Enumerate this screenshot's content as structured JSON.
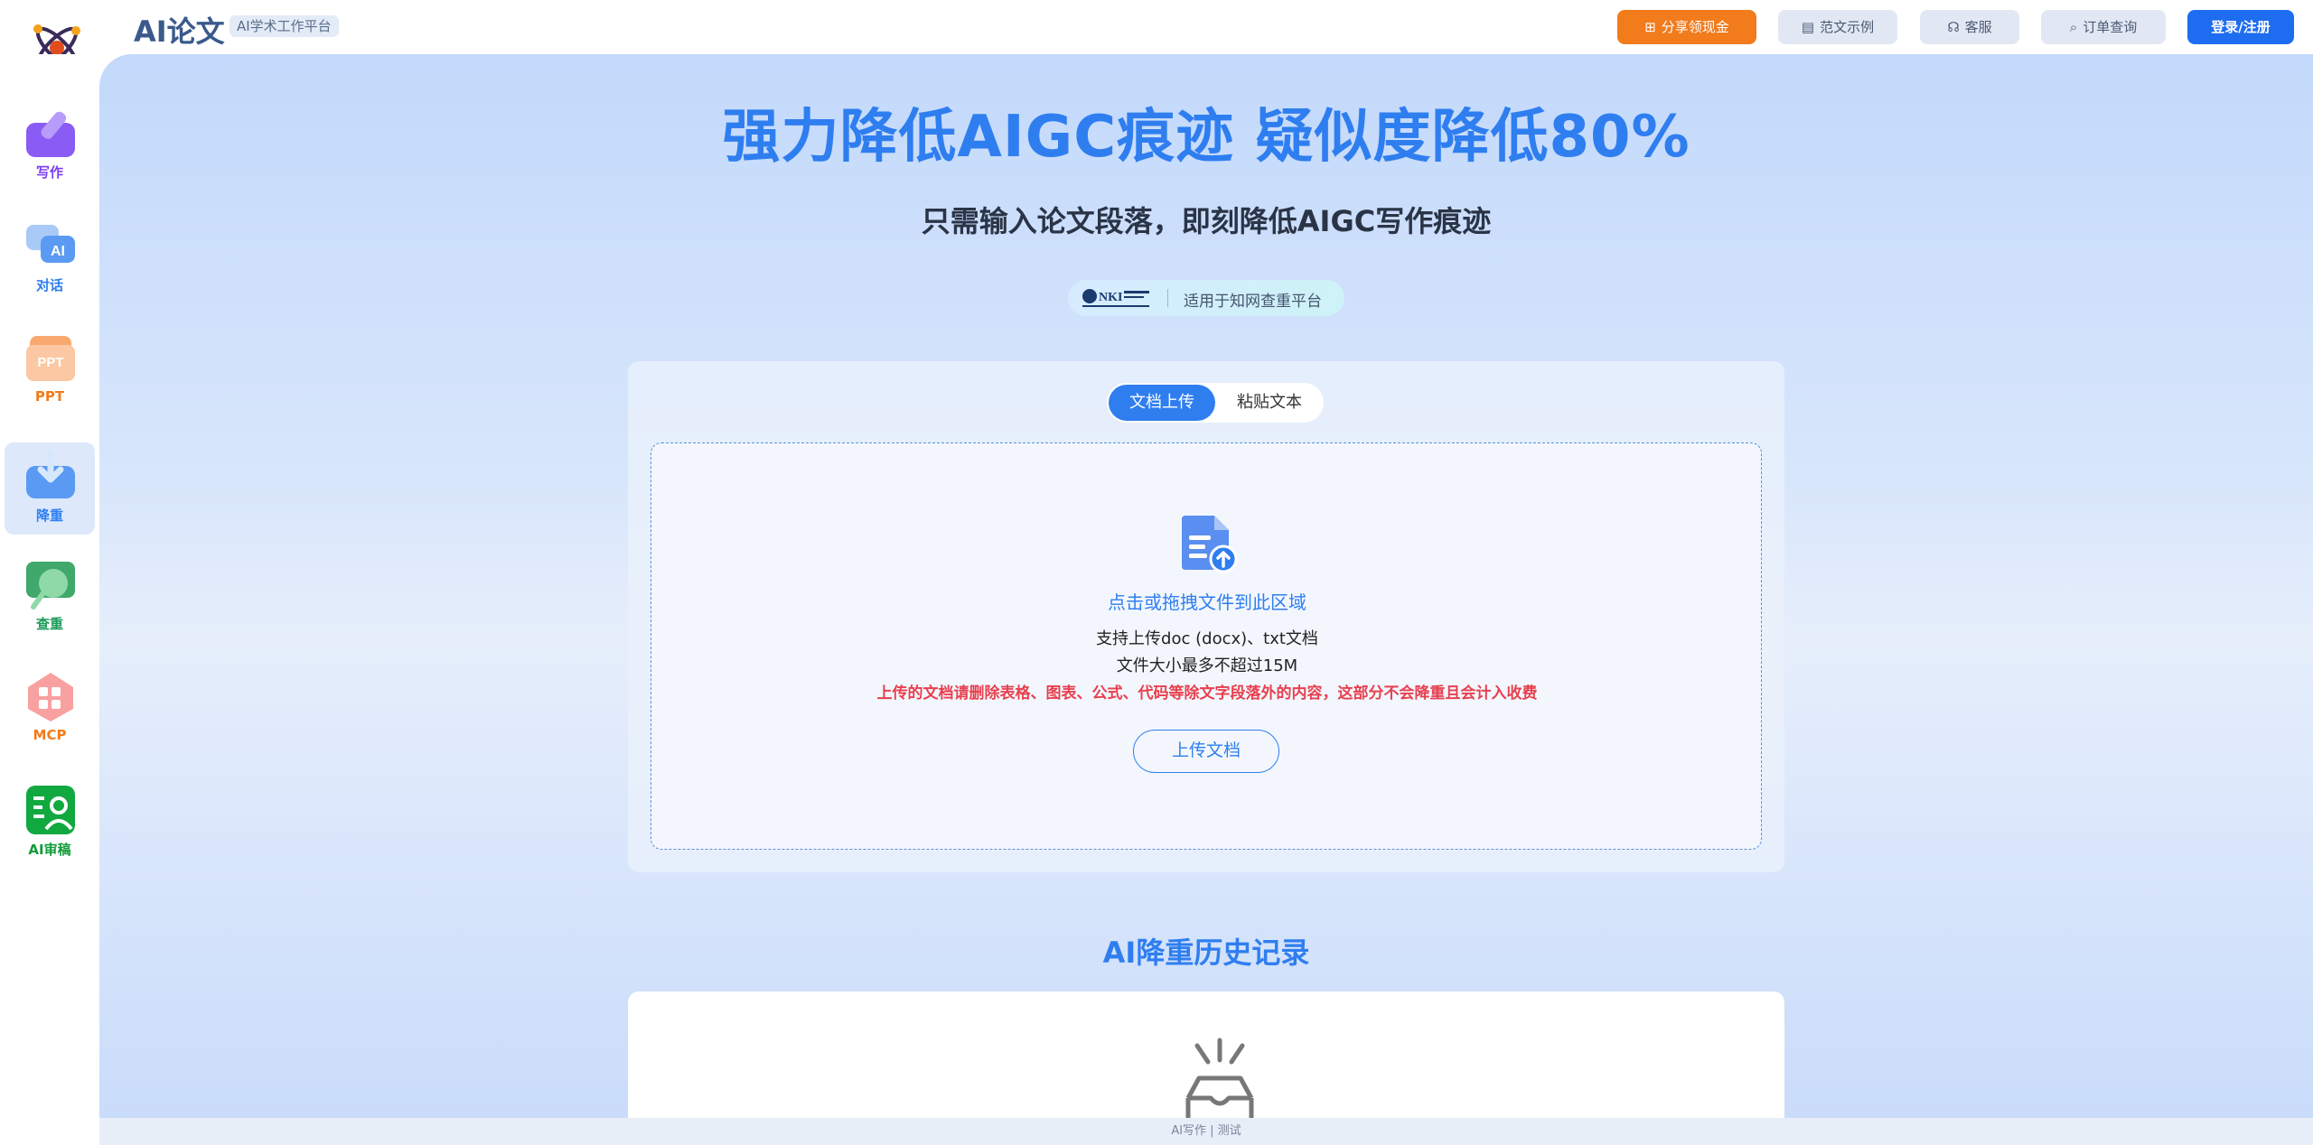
{
  "header": {
    "brand": "AI论文",
    "brand_tag": "AI学术工作平台",
    "buttons": {
      "share": "分享领现金",
      "sample": "范文示例",
      "service": "客服",
      "order": "订单查询",
      "login": "登录/注册"
    }
  },
  "sidebar": {
    "items": [
      {
        "label": "写作",
        "color": "#7b3ff2"
      },
      {
        "label": "对话",
        "color": "#2f7ef0"
      },
      {
        "label": "PPT",
        "color": "#f27b1c"
      },
      {
        "label": "降重",
        "color": "#2f7ef0"
      },
      {
        "label": "查重",
        "color": "#1c9a5a"
      },
      {
        "label": "MCP",
        "color": "#f27b1c"
      },
      {
        "label": "AI审稿",
        "color": "#129c3a"
      }
    ],
    "active_index": 3
  },
  "hero": {
    "title": "强力降低AIGC痕迹 疑似度降低80%",
    "subtitle": "只需输入论文段落，即刻降低AIGC写作痕迹",
    "badge_text": "适用于知网查重平台"
  },
  "upload": {
    "tabs": [
      "文档上传",
      "粘贴文本"
    ],
    "active_tab": 0,
    "drop_title": "点击或拖拽文件到此区域",
    "line1": "支持上传doc (docx)、txt文档",
    "line2": "文件大小最多不超过15M",
    "warning": "上传的文档请删除表格、图表、公式、代码等除文字段落外的内容，这部分不会降重且会计入收费",
    "button": "上传文档"
  },
  "history": {
    "title": "AI降重历史记录"
  },
  "footer": {
    "text": "AI写作 | 测试"
  },
  "colors": {
    "accent": "#2f7ef0",
    "share": "#f27b1c",
    "login": "#1e6cf0",
    "warning": "#e8404f"
  }
}
